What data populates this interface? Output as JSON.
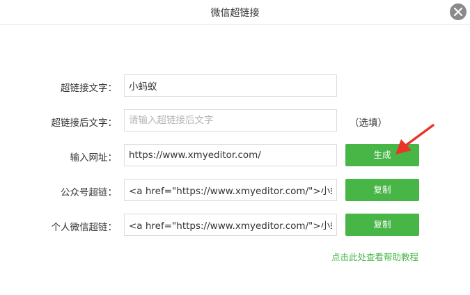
{
  "dialog": {
    "title": "微信超链接"
  },
  "form": {
    "link_text": {
      "label": "超链接文字：",
      "value": "小蚂蚁"
    },
    "after_text": {
      "label": "超链接后文字：",
      "placeholder": "请输入超链接后文字",
      "value": "",
      "hint": "（选填）"
    },
    "url": {
      "label": "输入网址：",
      "value": "https://www.xmyeditor.com/",
      "button_label": "生成"
    },
    "official_link": {
      "label": "公众号超链：",
      "value": "<a href=\"https://www.xmyeditor.com/\">小蚂蚁</a>",
      "button_label": "复制"
    },
    "personal_link": {
      "label": "个人微信超链：",
      "value": "<a href=\"https://www.xmyeditor.com/\">小蚂蚁</a>",
      "button_label": "复制"
    }
  },
  "help": {
    "link_text": "点击此处查看帮助教程"
  },
  "colors": {
    "accent_green": "#48b547",
    "arrow_red": "#e8352a",
    "close_gray": "#8a8a8a"
  },
  "icons": {
    "close": "close-x-icon",
    "annotation": "red-arrow-icon"
  }
}
